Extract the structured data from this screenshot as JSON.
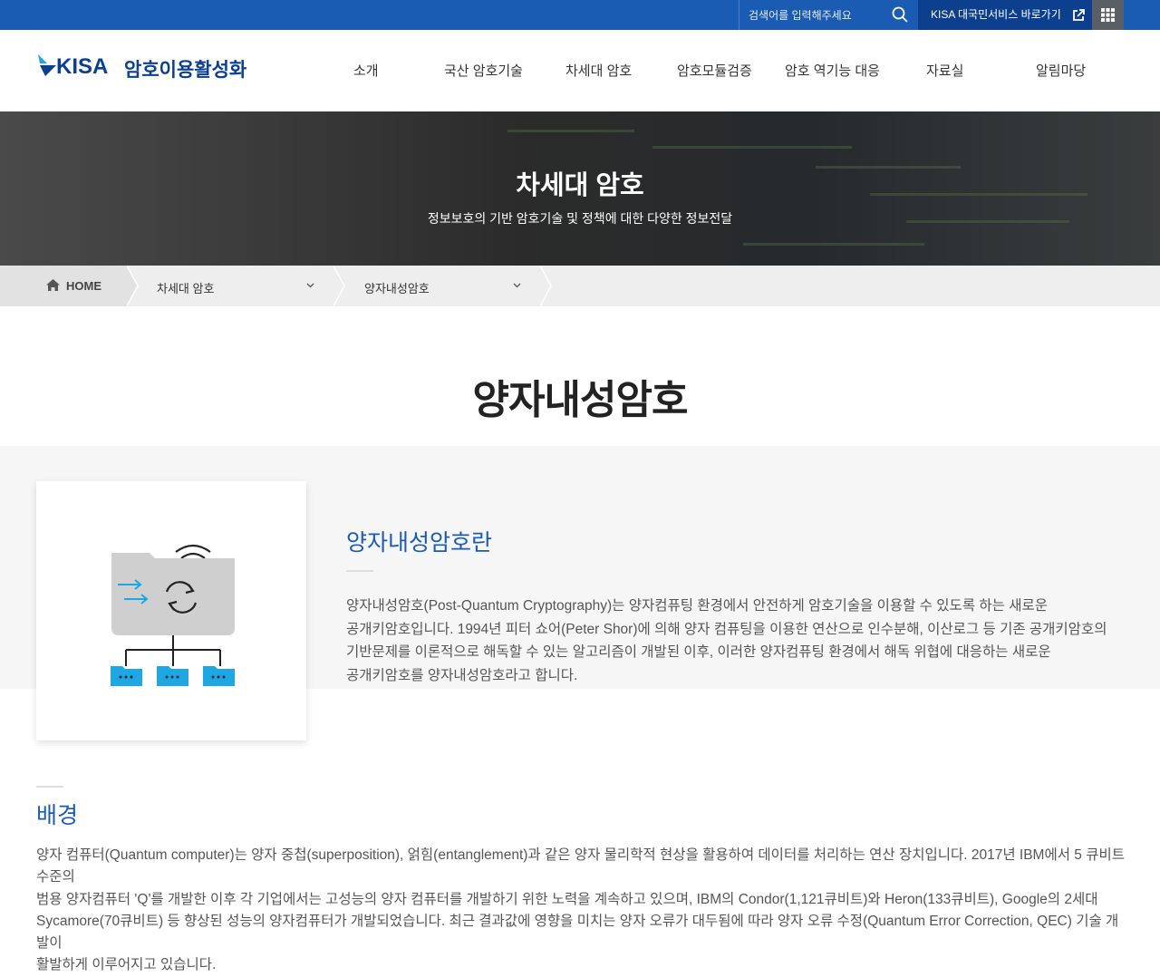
{
  "topbar": {
    "search_placeholder": "검색어를 입력해주세요",
    "external_link_label": "KISA 대국민서비스 바로가기"
  },
  "logo": {
    "brand": "KISA",
    "site_name": "암호이용활성화"
  },
  "nav": {
    "items": [
      {
        "label": "소개"
      },
      {
        "label": "국산 암호기술"
      },
      {
        "label": "차세대 암호"
      },
      {
        "label": "암호모듈검증"
      },
      {
        "label": "암호 역기능 대응"
      },
      {
        "label": "자료실"
      },
      {
        "label": "알림마당"
      }
    ]
  },
  "hero": {
    "title": "차세대 암호",
    "subtitle": "정보보호의 기반 암호기술 및 정책에 대한 다양한 정보전달"
  },
  "breadcrumb": {
    "home": "HOME",
    "level1": "차세대 암호",
    "level2": "양자내성암호"
  },
  "page": {
    "title": "양자내성암호"
  },
  "intro": {
    "heading": "양자내성암호란",
    "lines": [
      "양자내성암호(Post-Quantum Cryptography)는 양자컴퓨팅 환경에서 안전하게 암호기술을 이용할 수 있도록 하는 새로운",
      "공개키암호입니다. 1994년 피터 쇼어(Peter Shor)에 의해 양자 컴퓨팅을 이용한 연산으로 인수분해, 이산로그 등 기존 공개키암호의",
      "기반문제를 이론적으로 해독할 수 있는 알고리즘이 개발된 이후, 이러한 양자컴퓨팅 환경에서 해독 위협에 대응하는 새로운",
      "공개키암호를 양자내성암호라고 합니다."
    ]
  },
  "background": {
    "heading": "배경",
    "lines": [
      "양자 컴퓨터(Quantum computer)는 양자 중첩(superposition), 얽힘(entanglement)과 같은 양자 물리학적 현상을 활용하여 데이터를 처리하는 연산 장치입니다. 2017년 IBM에서 5 큐비트 수준의",
      "범용 양자컴퓨터 'Q'를 개발한 이후 각 기업에서는 고성능의 양자 컴퓨터를 개발하기 위한 노력을 계속하고 있으며, IBM의 Condor(1,121큐비트)와 Heron(133큐비트), Google의 2세대",
      "Sycamore(70큐비트) 등 향상된 성능의 양자컴퓨터가 개발되었습니다. 최근 결과값에 영향을 미치는 양자 오류가 대두됨에 따라 양자 오류 수정(Quantum Error Correction, QEC) 기술 개발이",
      "활발하게 이루어지고 있습니다."
    ]
  },
  "colors": {
    "primary": "#1a5bb3",
    "navy": "#0d3f8f",
    "accent_cyan": "#1ea7e1"
  }
}
